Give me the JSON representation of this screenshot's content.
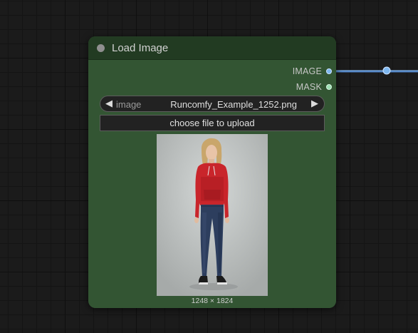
{
  "node": {
    "title": "Load Image",
    "outputs": [
      {
        "label": "IMAGE",
        "color": "#7fb8f0"
      },
      {
        "label": "MASK",
        "color": "#9fe0b4"
      }
    ],
    "image_widget": {
      "label": "image",
      "value": "Runcomfy_Example_1252.png",
      "left_arrow": "◀",
      "right_arrow": "▶"
    },
    "upload_button": {
      "label": "choose file to upload"
    },
    "preview": {
      "dimensions": "1248 × 1824"
    }
  },
  "colors": {
    "node_body": "#335533",
    "node_header": "#223b22",
    "link": "#7fb8f0"
  }
}
